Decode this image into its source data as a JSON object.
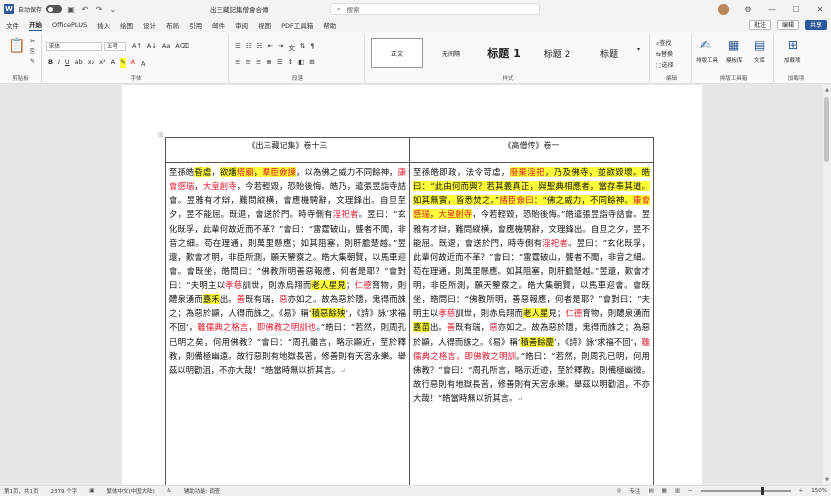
{
  "titlebar": {
    "app_icon": "W",
    "autosave_label": "自动保存",
    "autosave_toggle": "关",
    "doc_title": "出三藏記集僧會合傳",
    "search_placeholder": "搜索"
  },
  "menu": {
    "items": [
      "文件",
      "开始",
      "OfficePLUS",
      "插入",
      "绘图",
      "设计",
      "布局",
      "引用",
      "邮件",
      "审阅",
      "视图",
      "PDF工具箱",
      "帮助"
    ],
    "active": 1,
    "comment_btn": "批注",
    "edit_btn": "编辑",
    "share_btn": "共享"
  },
  "ribbon": {
    "font_name": "宋体",
    "font_size": "五号",
    "groups": [
      "剪贴板",
      "字体",
      "段落",
      "样式",
      "编辑",
      "排版工具箱",
      "加载项"
    ],
    "styles": [
      "正文",
      "无间隔",
      "标题 1",
      "标题 2",
      "标题"
    ],
    "edit_items": [
      "查找",
      "替换",
      "选择"
    ],
    "tools": [
      "排版工具",
      "模板库",
      "文库",
      "加载项"
    ]
  },
  "document": {
    "headers": [
      "《出三藏记集》卷十三",
      "《高僧传》卷一"
    ],
    "left": [
      {
        "t": "至孫皓",
        "s": ""
      },
      {
        "t": "昏虐",
        "s": "y"
      },
      {
        "t": "，",
        "s": ""
      },
      {
        "t": "欲燔",
        "s": "y"
      },
      {
        "t": "塔廟",
        "s": "yr"
      },
      {
        "t": "，",
        "s": "y"
      },
      {
        "t": "羣臣僉諫",
        "s": "yr"
      },
      {
        "t": "，以為佛之威力不同餘神，",
        "s": ""
      },
      {
        "t": "康會感瑞",
        "s": "r"
      },
      {
        "t": "，",
        "s": ""
      },
      {
        "t": "大皇創寺",
        "s": "r"
      },
      {
        "t": "，今若輕毀，恐貽後悔。皓乃，遣張昱詣寺詰會。昱雅有才辯，難問縱横，會應機騁辭，文理鋒出。自旦至夕，昱不能屈。既退，會送於門。時寺側有",
        "s": ""
      },
      {
        "t": "淫祀者",
        "s": "r"
      },
      {
        "t": "。昱曰：“玄化既孚，此輩何故近而不革？”會曰：“雷霆破山，聾者不聞，非音之細。苟在理通，則萬里懸應；如其阻塞，則肝膽楚越。”昱還，歎會才明，非臣所測，願天鑒察之。皓大集朝賢，以馬車迎會。會既坐，皓問曰：“佛教所明善惡報應，何者是耶？”會對曰：“夫明主以",
        "s": ""
      },
      {
        "t": "孝慈",
        "s": "r"
      },
      {
        "t": "訓世，則赤烏翔而",
        "s": ""
      },
      {
        "t": "老人星見",
        "s": "y"
      },
      {
        "t": "；",
        "s": ""
      },
      {
        "t": "仁德",
        "s": "r"
      },
      {
        "t": "育物，則醴泉湧而",
        "s": ""
      },
      {
        "t": "嘉禾",
        "s": "y"
      },
      {
        "t": "出。",
        "s": ""
      },
      {
        "t": "善",
        "s": "r"
      },
      {
        "t": "既有瑞，",
        "s": ""
      },
      {
        "t": "惡",
        "s": "r"
      },
      {
        "t": "亦如之。故為惡於隱，鬼得而誅之；為惡於顯，人得而誅之。《易》稱‘",
        "s": ""
      },
      {
        "t": "積惡餘殃",
        "s": "y"
      },
      {
        "t": "’，《詩》詠‘求福不回’，",
        "s": ""
      },
      {
        "t": "雖儒典之格言，即佛教之明訓也",
        "s": "r"
      },
      {
        "t": "。”皓曰：“若然，則周孔已明之矣，何用佛教？”會曰：“周孔雖言，略示顯近，至於釋教，則備極幽遠。故行惡則有地獄長苦，修善則有天宮永樂。舉茲以明勸沮，不亦大哉！”皓當時無以折其言。",
        "s": ""
      }
    ],
    "right": [
      {
        "t": "至孫皓即政，法令苛虐，",
        "s": ""
      },
      {
        "t": "廢棄淫祀",
        "s": "yr"
      },
      {
        "t": "，乃及佛寺，並欲毀壞。皓曰：“此由何而興？若其義真正，與聖典相應者，當存奉其道。如其無實，皆悉焚之。”",
        "s": "y"
      },
      {
        "t": "諸臣僉曰",
        "s": "yr"
      },
      {
        "t": "：“佛之威力，不同餘神。",
        "s": "y"
      },
      {
        "t": "康會感瑞",
        "s": "yr"
      },
      {
        "t": "，",
        "s": "y"
      },
      {
        "t": "大皇創寺",
        "s": "yr"
      },
      {
        "t": "，今若輕毀，恐貽後悔。”皓遣張昱詣寺詰會。昱雅有才辯，難問縱横，會應機騁辭，文理鋒出。自旦之夕，昱不能屈。既退，會送於門，時寺側有",
        "s": ""
      },
      {
        "t": "淫祀者",
        "s": "r"
      },
      {
        "t": "。昱曰：“玄化既孚，此輩何故近而不革？”會曰：“雷霆破山，聾者不聞，非音之細。苟在理通，則萬里懸應。如其阻塞，則肝膽楚越。”昱還，歎會才明，非臣所測，願天鑒察之。皓大集朝賢，以馬車迎會。會既坐，皓問曰：“佛教所明，善惡報應，何者是耶？”會對曰：“夫明主以",
        "s": ""
      },
      {
        "t": "孝慈",
        "s": "r"
      },
      {
        "t": "訓世，則赤烏翔而",
        "s": ""
      },
      {
        "t": "老人星",
        "s": "y"
      },
      {
        "t": "見；",
        "s": ""
      },
      {
        "t": "仁德",
        "s": "r"
      },
      {
        "t": "育物，則醴泉湧而",
        "s": ""
      },
      {
        "t": "嘉苗",
        "s": "y"
      },
      {
        "t": "出。",
        "s": ""
      },
      {
        "t": "善",
        "s": "r"
      },
      {
        "t": "既有瑞，",
        "s": ""
      },
      {
        "t": "惡",
        "s": "r"
      },
      {
        "t": "亦如之。故為惡於隱，鬼得而誅之；為惡於顯，人得而誅之。《易》稱‘",
        "s": ""
      },
      {
        "t": "積善餘慶",
        "s": "y"
      },
      {
        "t": "’，《詩》詠‘求福不回’，",
        "s": ""
      },
      {
        "t": "雖儒典之格言，即佛教之明訓",
        "s": "r"
      },
      {
        "t": "。”皓曰：“若然，則周孔已明，何用佛教？”會曰：“周孔所言，略示近迹，至於釋教，則備極幽微。故行惡則有地獄長苦，修善則有天宮永樂。舉茲以明勸沮，不亦大哉！”皓當時無以折其言。",
        "s": ""
      }
    ]
  },
  "statusbar": {
    "page": "第1页，共1页",
    "words": "2379 个字",
    "lang": "繁体中文(中国大陆)",
    "accessibility": "辅助功能: 调查",
    "focus": "专注",
    "zoom": "150%"
  }
}
